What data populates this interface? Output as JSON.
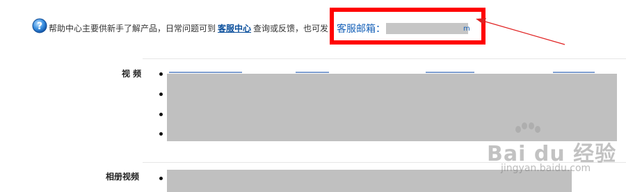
{
  "notice": {
    "text_before": "帮助中心主要供新手了解产品，日常问题可到",
    "link_label": "客服中心",
    "text_after": "查询或反馈，也可发"
  },
  "email": {
    "label": "客服邮箱：",
    "tail": "m"
  },
  "sections": {
    "video": {
      "label": "视 频"
    },
    "album_video": {
      "label": "相册视频"
    }
  },
  "watermark": {
    "brand": "Bai du 经验",
    "url": "jingyan.baidu.com"
  },
  "colors": {
    "highlight": "#ff0000",
    "link": "#0a4f9c",
    "redaction": "#c0c0c0"
  }
}
